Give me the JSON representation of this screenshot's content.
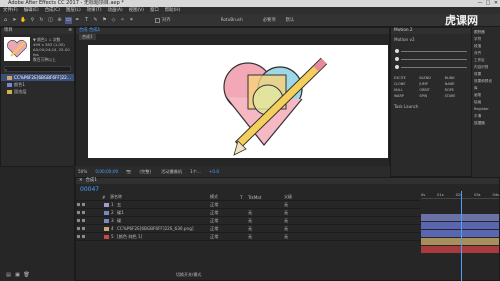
{
  "window": {
    "title": "Adobe After Effects CC 2017 - 无标题项目.aep *",
    "min": "—",
    "max": "□",
    "close": "✕"
  },
  "menu": [
    "文件(F)",
    "编辑(E)",
    "合成(C)",
    "图层(L)",
    "效果(T)",
    "动画(A)",
    "视图(V)",
    "窗口",
    "帮助(H)"
  ],
  "toolbar": {
    "snap_label": "对齐",
    "roto_label": "RotoBrush",
    "workspace_label": "必要项",
    "workspace2": "默认",
    "brand": "虎课网"
  },
  "project": {
    "tab": "项目",
    "tab_menu": "≡",
    "preview_title": "▼ 颜色1 ↓ 次数",
    "preview_info": "499 x 383 (1.00)",
    "preview_sub": "Δ0;00;04;24, 25.00 fps",
    "preview_extra": "数百万种以上",
    "search_placeholder": "ρ",
    "items": [
      {
        "name": "CC%P6F2E[6BGBF6FF]22...",
        "selected": true
      },
      {
        "name": "颜色1",
        "selected": false
      },
      {
        "name": "固态层",
        "selected": false
      }
    ]
  },
  "composition": {
    "tab": "合成 合成1",
    "breadcrumb": "合成1",
    "zoom": "50%",
    "timecode": "0;00;00;00",
    "resolution": "(完整)",
    "camera": "活动摄像机",
    "views": "1个...",
    "exposure": "+0.0"
  },
  "right_panel": {
    "title": "Motion 2",
    "version": "Motion v2",
    "buttons": [
      "EXCITE",
      "BLEND",
      "BLINK",
      "CLONE",
      "JUMP",
      "NAME",
      "NULL",
      "ORBIT",
      "ROPE",
      "WARP",
      "SPIN",
      "STARE"
    ],
    "footer": "Task Launch"
  },
  "right_column": [
    "跟踪器",
    "字符",
    "段落",
    "对齐",
    "工作区",
    "内容识别",
    "效果",
    "效果和预设",
    "库",
    "画笔",
    "绘画",
    "Register",
    "平滑",
    "摇摆器"
  ],
  "timeline": {
    "tab": "合成1",
    "timecode": "00047",
    "columns": [
      "#",
      "源名称",
      "模式",
      "T",
      "TrkMat",
      "父级"
    ],
    "layers": [
      {
        "num": "1",
        "name": "五",
        "mode": "正常",
        "trk": "",
        "parent": "无",
        "color": "#9aa0c8"
      },
      {
        "num": "2",
        "name": "碟1",
        "mode": "正常",
        "trk": "无",
        "parent": "无",
        "color": "#7a86c8"
      },
      {
        "num": "3",
        "name": "碟",
        "mode": "正常",
        "trk": "无",
        "parent": "无",
        "color": "#7a86c8"
      },
      {
        "num": "4",
        "name": "CC%P6F2E[6BGBF6FF]22S_630.png]",
        "mode": "正常",
        "trk": "无",
        "parent": "无",
        "color": "#c8a86a"
      },
      {
        "num": "5",
        "name": "[颜色 纯色 1]",
        "mode": "正常",
        "trk": "无",
        "parent": "无",
        "color": "#c84a4a"
      }
    ],
    "ruler": [
      "0s",
      "01s",
      "02s",
      "03s",
      "04s"
    ],
    "footer": "切换开关/模式"
  },
  "colors": {
    "accent": "#4aa0ff",
    "selection": "#4a5a8a"
  }
}
